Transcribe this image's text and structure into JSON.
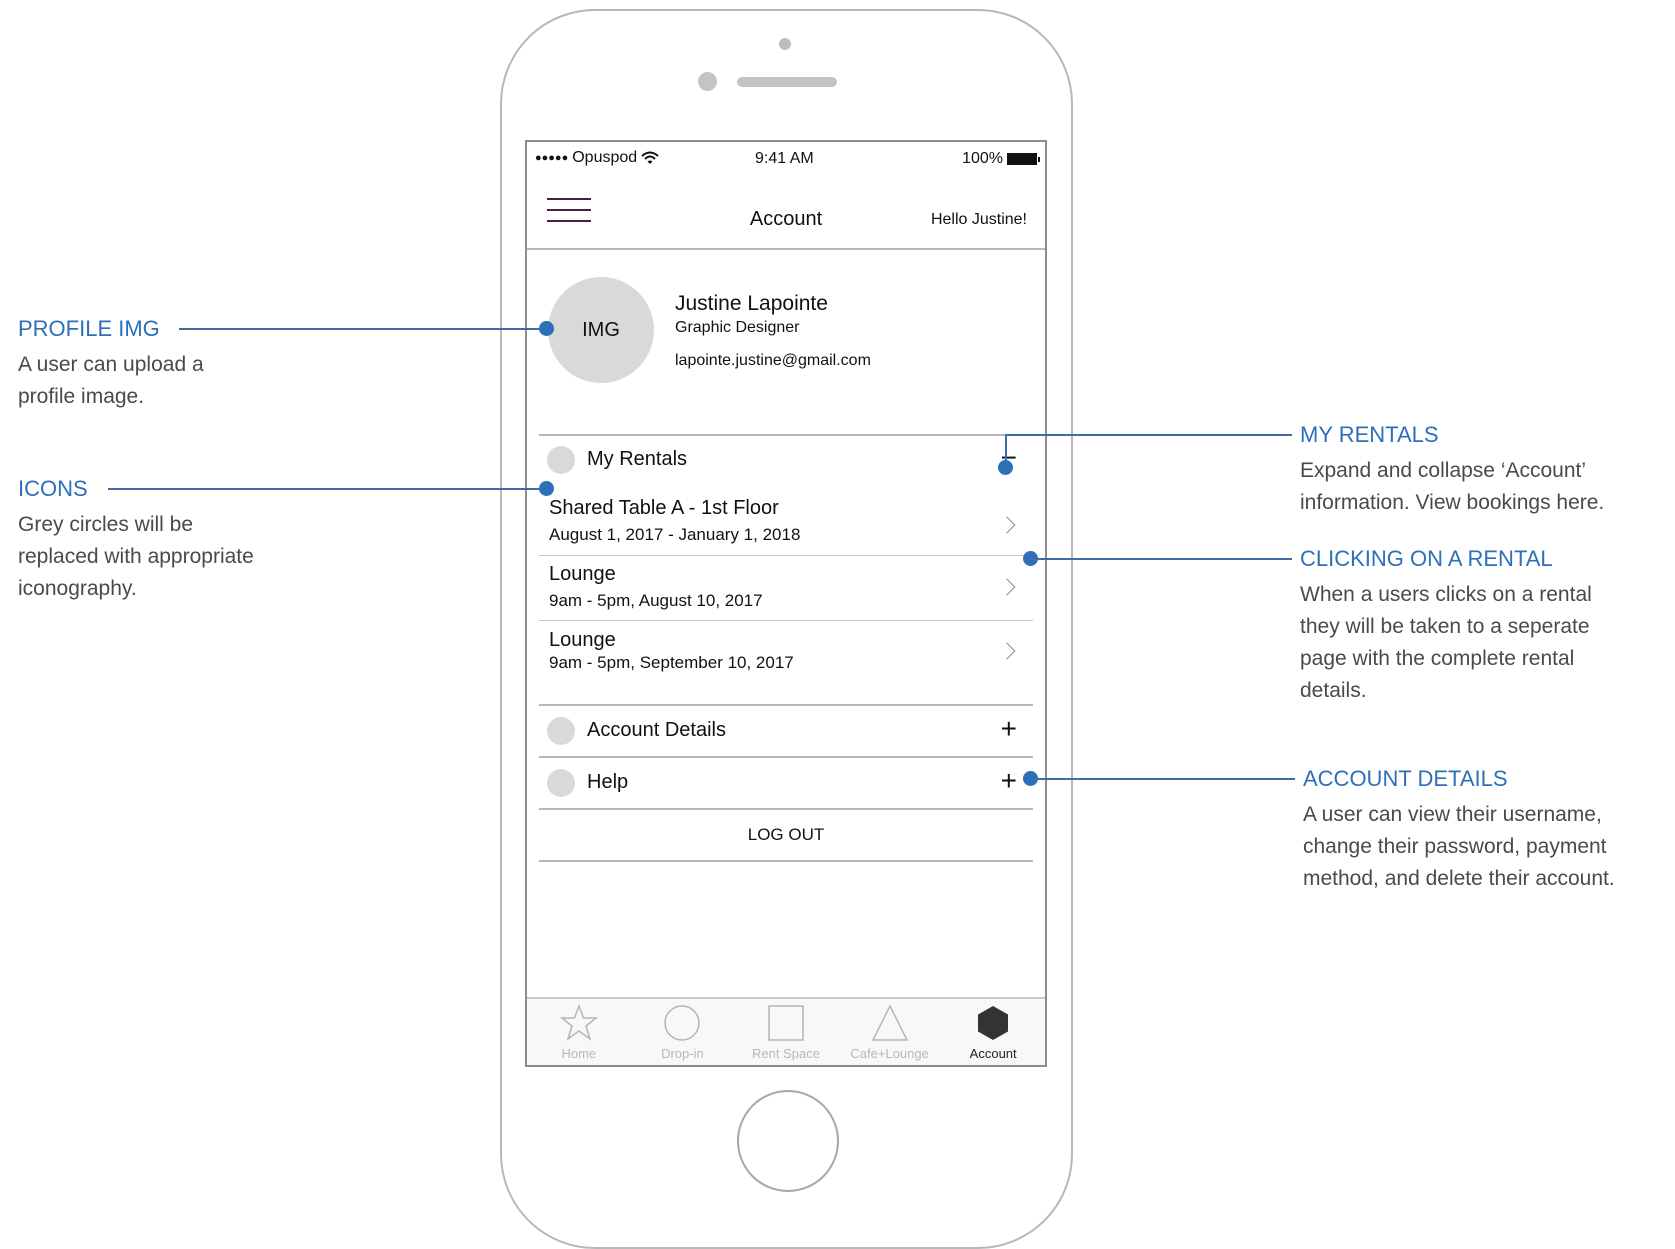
{
  "status_bar": {
    "carrier": "Opuspod",
    "signal": "●●●●●",
    "time": "9:41 AM",
    "battery": "100%"
  },
  "nav": {
    "title": "Account",
    "greeting": "Hello Justine!"
  },
  "profile": {
    "avatar_text": "IMG",
    "name": "Justine Lapointe",
    "role": "Graphic Designer",
    "email": "lapointe.justine@gmail.com"
  },
  "sections": {
    "rentals": {
      "label": "My Rentals",
      "toggle": "−"
    },
    "account_details": {
      "label": "Account Details",
      "toggle": "+"
    },
    "help": {
      "label": "Help",
      "toggle": "+"
    }
  },
  "rentals": [
    {
      "title": "Shared Table A - 1st Floor",
      "date": "August 1, 2017 - January 1, 2018"
    },
    {
      "title": "Lounge",
      "date": "9am - 5pm, August 10, 2017"
    },
    {
      "title": "Lounge",
      "date": "9am - 5pm, September 10, 2017"
    }
  ],
  "logout_label": "LOG OUT",
  "tabs": [
    {
      "label": "Home",
      "icon": "star-icon",
      "active": false
    },
    {
      "label": "Drop-in",
      "icon": "circle-icon",
      "active": false
    },
    {
      "label": "Rent Space",
      "icon": "square-icon",
      "active": false
    },
    {
      "label": "Cafe+Lounge",
      "icon": "triangle-icon",
      "active": false
    },
    {
      "label": "Account",
      "icon": "hexagon-icon",
      "active": true
    }
  ],
  "annotations": {
    "profile_img": {
      "title": "PROFILE IMG",
      "body": [
        "A user can upload a",
        "profile image."
      ]
    },
    "icons": {
      "title": "ICONS",
      "body": [
        "Grey circles will be",
        "replaced with appropriate",
        "iconography."
      ]
    },
    "my_rentals": {
      "title": "MY RENTALS",
      "body": [
        "Expand and collapse ‘Account’",
        "information. View bookings here."
      ]
    },
    "clicking_rental": {
      "title": "CLICKING ON A RENTAL",
      "body": [
        "When a users clicks on a rental",
        "they will be taken to a seperate",
        "page with the complete rental",
        "details."
      ]
    },
    "account_details": {
      "title": "ACCOUNT DETAILS",
      "body": [
        "A user can view their username,",
        "change their password, payment",
        "method, and delete their account."
      ]
    }
  },
  "colors": {
    "annotation_blue": "#2e6fb9",
    "avatar_grey": "#d9d9d9",
    "hamburger": "#4b1f45"
  }
}
